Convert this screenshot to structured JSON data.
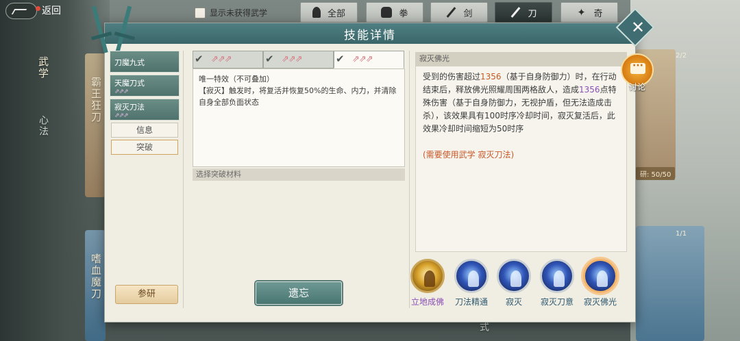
{
  "topbar": {
    "back_label": "返回",
    "filter_label": "显示未获得武学",
    "categories": [
      {
        "label": "全部",
        "icon": "person-icon"
      },
      {
        "label": "拳",
        "icon": "fist-icon"
      },
      {
        "label": "剑",
        "icon": "sword-icon"
      },
      {
        "label": "刀",
        "icon": "blade-icon",
        "active": true
      },
      {
        "label": "奇",
        "icon": "shuriken-icon"
      }
    ]
  },
  "background": {
    "side_labels": [
      "武学",
      "心法"
    ],
    "cards": [
      {
        "name": "霸王狂刀"
      },
      {
        "name": "嗜血魔刀"
      }
    ],
    "right_counters": [
      "2/2",
      "1/1"
    ],
    "research_progress": "研: 50/50",
    "bottom_fragment": "式"
  },
  "dialog": {
    "title": "技能详情",
    "moves": [
      {
        "name": "刀魔九式",
        "arrows": ""
      },
      {
        "name": "天魔刀式",
        "arrows": "⇗⇗⇗"
      },
      {
        "name": "寂灭刀法",
        "arrows": "⇗⇗⇗"
      }
    ],
    "sub_buttons": {
      "info": "信息",
      "breakthrough": "突破"
    },
    "research_label": "参研",
    "level_tabs": [
      {
        "arrows": "⇗⇗⇗",
        "checked": true
      },
      {
        "arrows": "⇗⇗⇗",
        "checked": true
      },
      {
        "arrows": "⇗⇗⇗",
        "checked": true,
        "active": true
      }
    ],
    "effect": {
      "line1": "唯一特效（不可叠加）",
      "line2": "【寂灭】触发时，将复活并恢复50%的生命、内力，并清除自身全部负面状态"
    },
    "material_label": "选择突破材料",
    "forget_label": "遗忘",
    "skill_name": "寂灭佛光",
    "description": {
      "p1": "受到的伤害超过",
      "v1": "1356",
      "p2": "（基于自身防御力）时，在行动结束后，释放佛光照耀周围两格敌人，造成",
      "v2": "1356",
      "p3": "点特殊伤害（基于自身防御力，无视护盾，但无法造成击杀），该效果具有100时序冷却时间，寂灭复活后，此效果冷却时间缩短为50时序",
      "requirement": "(需要使用武学 寂灭刀法)"
    },
    "skills": [
      {
        "label": "立地成佛",
        "style": "gold"
      },
      {
        "label": "刀法精通",
        "style": "blue"
      },
      {
        "label": "寂灭",
        "style": "blue"
      },
      {
        "label": "寂灭刀意",
        "style": "blue"
      },
      {
        "label": "寂灭佛光",
        "style": "blue",
        "selected": true
      }
    ]
  },
  "discussion": {
    "label": "讨论"
  },
  "colors": {
    "header": "#4f7f83",
    "panel": "#f0ede2",
    "highlight_orange": "#c85a22",
    "highlight_purple": "#8a4fb8"
  }
}
